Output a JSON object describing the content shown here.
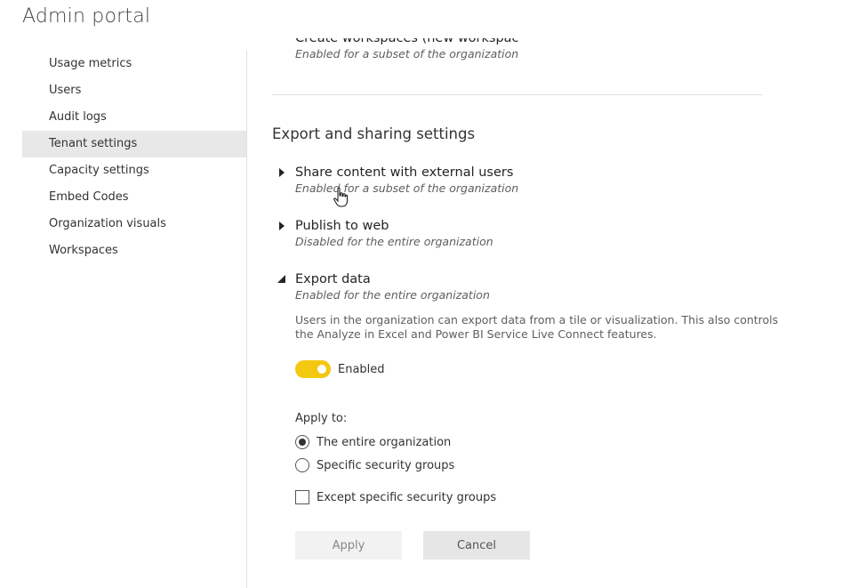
{
  "header": {
    "title": "Admin portal"
  },
  "sidebar": {
    "items": [
      {
        "label": "Usage metrics",
        "selected": false
      },
      {
        "label": "Users",
        "selected": false
      },
      {
        "label": "Audit logs",
        "selected": false
      },
      {
        "label": "Tenant settings",
        "selected": true
      },
      {
        "label": "Capacity settings",
        "selected": false
      },
      {
        "label": "Embed Codes",
        "selected": false
      },
      {
        "label": "Organization visuals",
        "selected": false
      },
      {
        "label": "Workspaces",
        "selected": false
      }
    ]
  },
  "content": {
    "top_setting": {
      "title": "Create workspaces (new workspace experience)",
      "status": "Enabled for a subset of the organization"
    },
    "section_title": "Export and sharing settings",
    "settings": [
      {
        "title": "Share content with external users",
        "status": "Enabled for a subset of the organization",
        "expanded": false
      },
      {
        "title": "Publish to web",
        "status": "Disabled for the entire organization",
        "expanded": false
      },
      {
        "title": "Export data",
        "status": "Enabled for the entire organization",
        "expanded": true
      }
    ],
    "export_data": {
      "description": "Users in the organization can export data from a tile or visualization. This also controls the Analyze in Excel and Power BI Service Live Connect features.",
      "toggle_label": "Enabled",
      "toggle_on": true,
      "apply_to_label": "Apply to:",
      "options": [
        {
          "label": "The entire organization",
          "checked": true
        },
        {
          "label": "Specific security groups",
          "checked": false
        }
      ],
      "except_label": "Except specific security groups",
      "except_checked": false,
      "apply_button": "Apply",
      "cancel_button": "Cancel"
    }
  },
  "colors": {
    "accent_toggle": "#f2c811",
    "selected_bg": "#e8e8e8"
  },
  "icons": {
    "collapsed": "caret-right-icon",
    "expanded": "caret-down-icon",
    "cursor": "hand-pointer-icon"
  }
}
